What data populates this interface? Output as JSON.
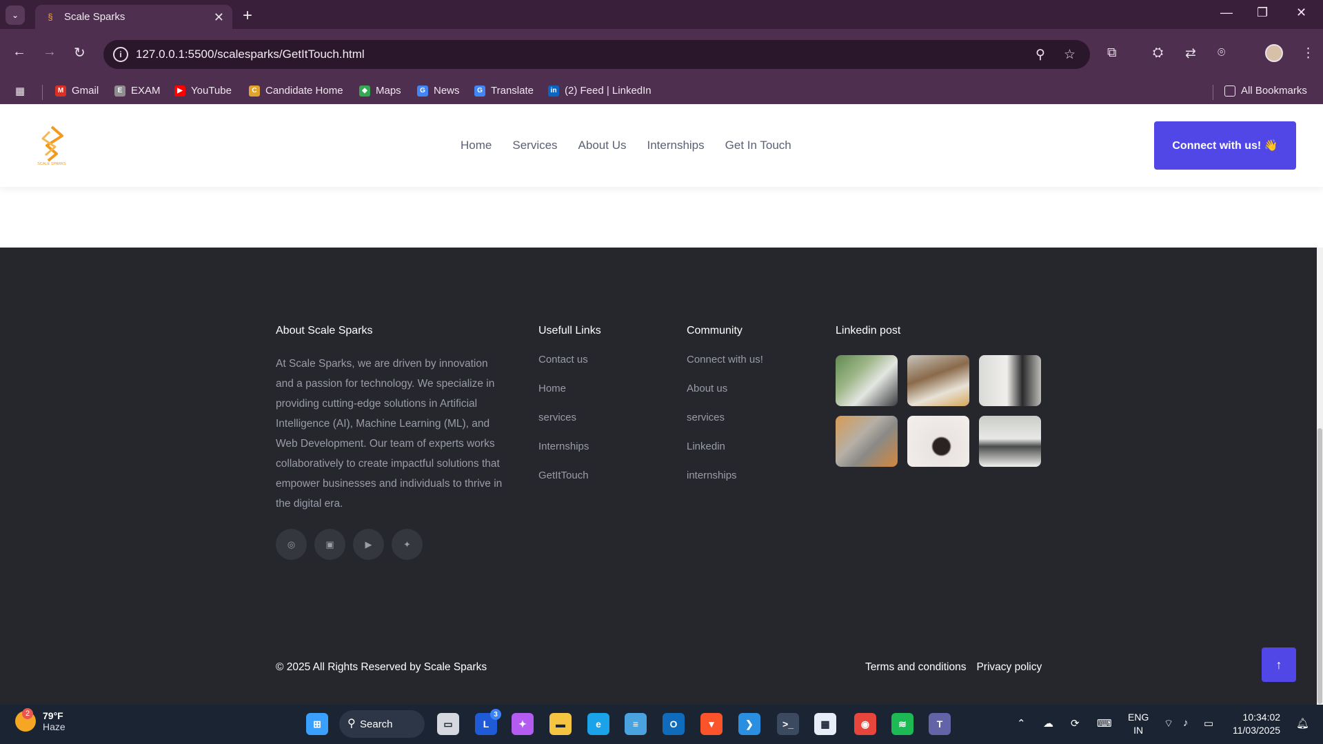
{
  "browser": {
    "tab_title": "Scale Sparks",
    "url": "127.0.0.1:5500/scalesparks/GetItTouch.html",
    "bookmarks": [
      {
        "label": "Gmail",
        "color": "#d93025",
        "glyph": "M"
      },
      {
        "label": "EXAM",
        "color": "#8e8e8e",
        "glyph": "E"
      },
      {
        "label": "YouTube",
        "color": "#ff0000",
        "glyph": "▶"
      },
      {
        "label": "Candidate Home",
        "color": "#e0a32b",
        "glyph": "C"
      },
      {
        "label": "Maps",
        "color": "#34a853",
        "glyph": "◆"
      },
      {
        "label": "News",
        "color": "#4285f4",
        "glyph": "G"
      },
      {
        "label": "Translate",
        "color": "#4285f4",
        "glyph": "G"
      },
      {
        "label": "(2) Feed | LinkedIn",
        "color": "#0a66c2",
        "glyph": "in"
      }
    ],
    "all_bookmarks": "All Bookmarks"
  },
  "site": {
    "logo_text": "SCALE SPARKS",
    "nav": [
      "Home",
      "Services",
      "About Us",
      "Internships",
      "Get In Touch"
    ],
    "connect_label": "Connect with us! 👋",
    "accent_color": "#5147e6"
  },
  "footer": {
    "about_title": "About Scale Sparks",
    "about_text": "At Scale Sparks, we are driven by innovation and a passion for technology. We specialize in providing cutting-edge solutions in Artificial Intelligence (AI), Machine Learning (ML), and Web Development. Our team of experts works collaboratively to create impactful solutions that empower businesses and individuals to thrive in the digital era.",
    "links_title": "Usefull Links",
    "links": [
      "Contact us",
      "Home",
      "services",
      "Internships",
      "GetItTouch"
    ],
    "community_title": "Community",
    "community": [
      "Connect with us!",
      "About us",
      "services",
      "Linkedin",
      "internships"
    ],
    "linkedin_title": "Linkedin post",
    "socials": [
      "whatsapp-icon",
      "linkedin-icon",
      "youtube-icon",
      "twitter-icon"
    ],
    "copyright": "© 2025 All Rights Reserved by Scale Sparks",
    "terms": "Terms and conditions",
    "privacy": "Privacy policy"
  },
  "taskbar": {
    "weather_temp": "79°F",
    "weather_desc": "Haze",
    "weather_badge": "2",
    "search_label": "Search",
    "lang_top": "ENG",
    "lang_bottom": "IN",
    "time": "10:34:02",
    "date": "11/03/2025",
    "apps": [
      {
        "name": "windows-start-icon",
        "color": "#3aa0ff",
        "glyph": "⊞"
      },
      {
        "name": "task-view-icon",
        "color": "#d5d8de",
        "glyph": "▭"
      },
      {
        "name": "app-l-icon",
        "color": "#1f5bd6",
        "glyph": "L",
        "badge": "3"
      },
      {
        "name": "copilot-icon",
        "color": "#b45cf0",
        "glyph": "✦"
      },
      {
        "name": "file-explorer-icon",
        "color": "#f5c542",
        "glyph": "▬"
      },
      {
        "name": "edge-icon",
        "color": "#1aa3e8",
        "glyph": "e"
      },
      {
        "name": "notepad-icon",
        "color": "#4aa3df",
        "glyph": "≡"
      },
      {
        "name": "outlook-icon",
        "color": "#0f6cbd",
        "glyph": "O"
      },
      {
        "name": "brave-icon",
        "color": "#fb542b",
        "glyph": "▼"
      },
      {
        "name": "vscode-icon",
        "color": "#2a8fe0",
        "glyph": "❯"
      },
      {
        "name": "terminal-icon",
        "color": "#3b4a5e",
        "glyph": ">_"
      },
      {
        "name": "store-icon",
        "color": "#e8eef7",
        "glyph": "▦"
      },
      {
        "name": "chrome-icon",
        "color": "#e8453c",
        "glyph": "◉"
      },
      {
        "name": "spotify-icon",
        "color": "#1db954",
        "glyph": "≋"
      },
      {
        "name": "teams-icon",
        "color": "#6264a7",
        "glyph": "T"
      }
    ]
  }
}
